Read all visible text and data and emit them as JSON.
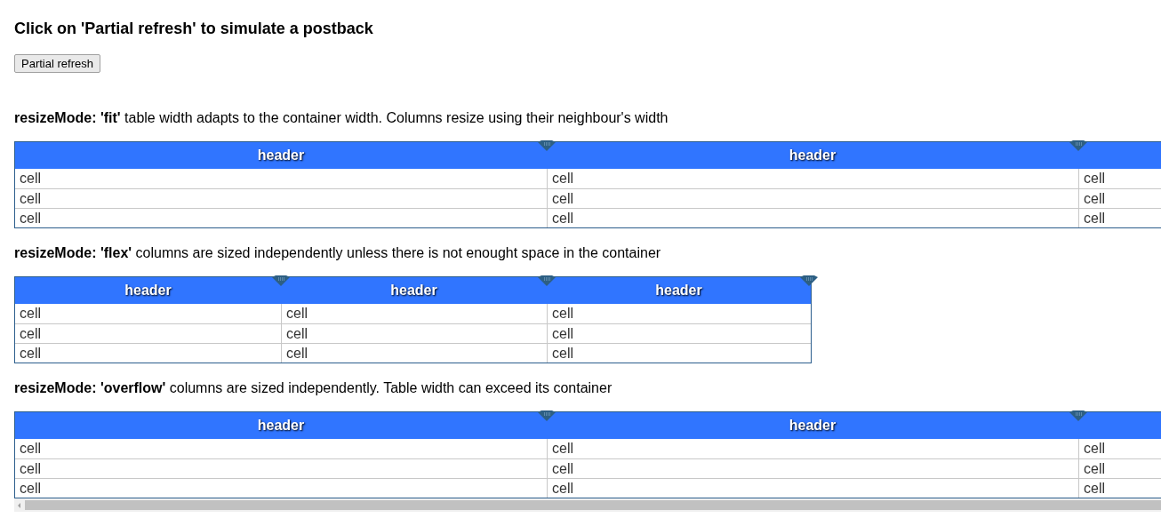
{
  "title": "Click on 'Partial refresh' to simulate a postback",
  "button": "Partial refresh",
  "sections": [
    {
      "kind": "fit",
      "description": "**resizeMode: 'fit'** table width adapts to the container width. Columns resize using their neighbour's width",
      "headers": [
        "header",
        "header"
      ],
      "rows": [
        [
          "cell",
          "cell",
          "cell"
        ],
        [
          "cell",
          "cell",
          "cell"
        ],
        [
          "cell",
          "cell",
          "cell"
        ]
      ]
    },
    {
      "kind": "flex",
      "description": "**resizeMode: 'flex'** columns are sized independently unless there is not enought space in the container",
      "headers": [
        "header",
        "header",
        "header"
      ],
      "rows": [
        [
          "cell",
          "cell",
          "cell"
        ],
        [
          "cell",
          "cell",
          "cell"
        ],
        [
          "cell",
          "cell",
          "cell"
        ]
      ]
    },
    {
      "kind": "overflow",
      "description": "**resizeMode: 'overflow'** columns are sized independently. Table width can exceed its container",
      "headers": [
        "header",
        "header"
      ],
      "rows": [
        [
          "cell",
          "cell",
          "cell"
        ],
        [
          "cell",
          "cell",
          "cell"
        ],
        [
          "cell",
          "cell",
          "cell"
        ]
      ]
    }
  ]
}
